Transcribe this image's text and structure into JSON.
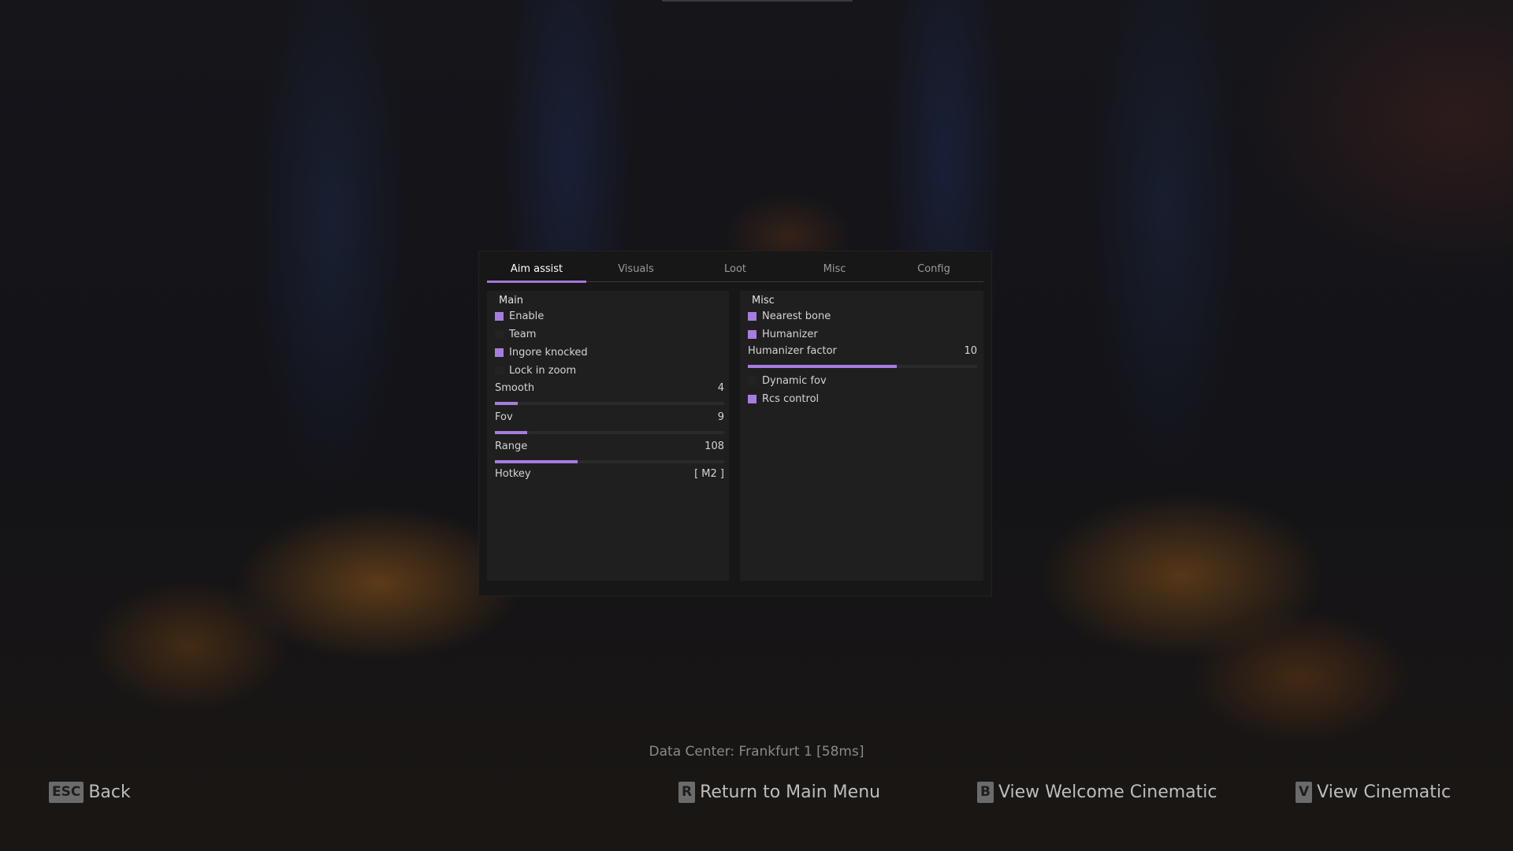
{
  "tabs": [
    {
      "label": "Aim assist",
      "active": true
    },
    {
      "label": "Visuals",
      "active": false
    },
    {
      "label": "Loot",
      "active": false
    },
    {
      "label": "Misc",
      "active": false
    },
    {
      "label": "Config",
      "active": false
    }
  ],
  "main": {
    "title": "Main",
    "checkboxes": [
      {
        "label": "Enable",
        "checked": true
      },
      {
        "label": "Team",
        "checked": false
      },
      {
        "label": "Ingore knocked",
        "checked": true
      },
      {
        "label": "Lock in zoom",
        "checked": false
      }
    ],
    "sliders": [
      {
        "label": "Smooth",
        "value": "4",
        "fill_fraction": 0.1
      },
      {
        "label": "Fov",
        "value": "9",
        "fill_fraction": 0.14
      },
      {
        "label": "Range",
        "value": "108",
        "fill_fraction": 0.36
      }
    ],
    "hotkey": {
      "label": "Hotkey",
      "value": "[ M2 ]"
    }
  },
  "misc": {
    "title": "Misc",
    "checkboxes_top": [
      {
        "label": "Nearest bone",
        "checked": true
      },
      {
        "label": "Humanizer",
        "checked": true
      }
    ],
    "slider": {
      "label": "Humanizer factor",
      "value": "10",
      "fill_fraction": 0.65
    },
    "checkboxes_bottom": [
      {
        "label": "Dynamic fov",
        "checked": false
      },
      {
        "label": "Rcs control",
        "checked": true
      }
    ]
  },
  "status": {
    "datacenter": "Data Center: Frankfurt 1 [58ms]"
  },
  "footer": [
    {
      "key": "ESC",
      "label": "Back"
    },
    {
      "key": "R",
      "label": "Return to Main Menu"
    },
    {
      "key": "B",
      "label": "View Welcome Cinematic"
    },
    {
      "key": "V",
      "label": "View Cinematic"
    }
  ],
  "colors": {
    "accent": "#a77cdf"
  }
}
